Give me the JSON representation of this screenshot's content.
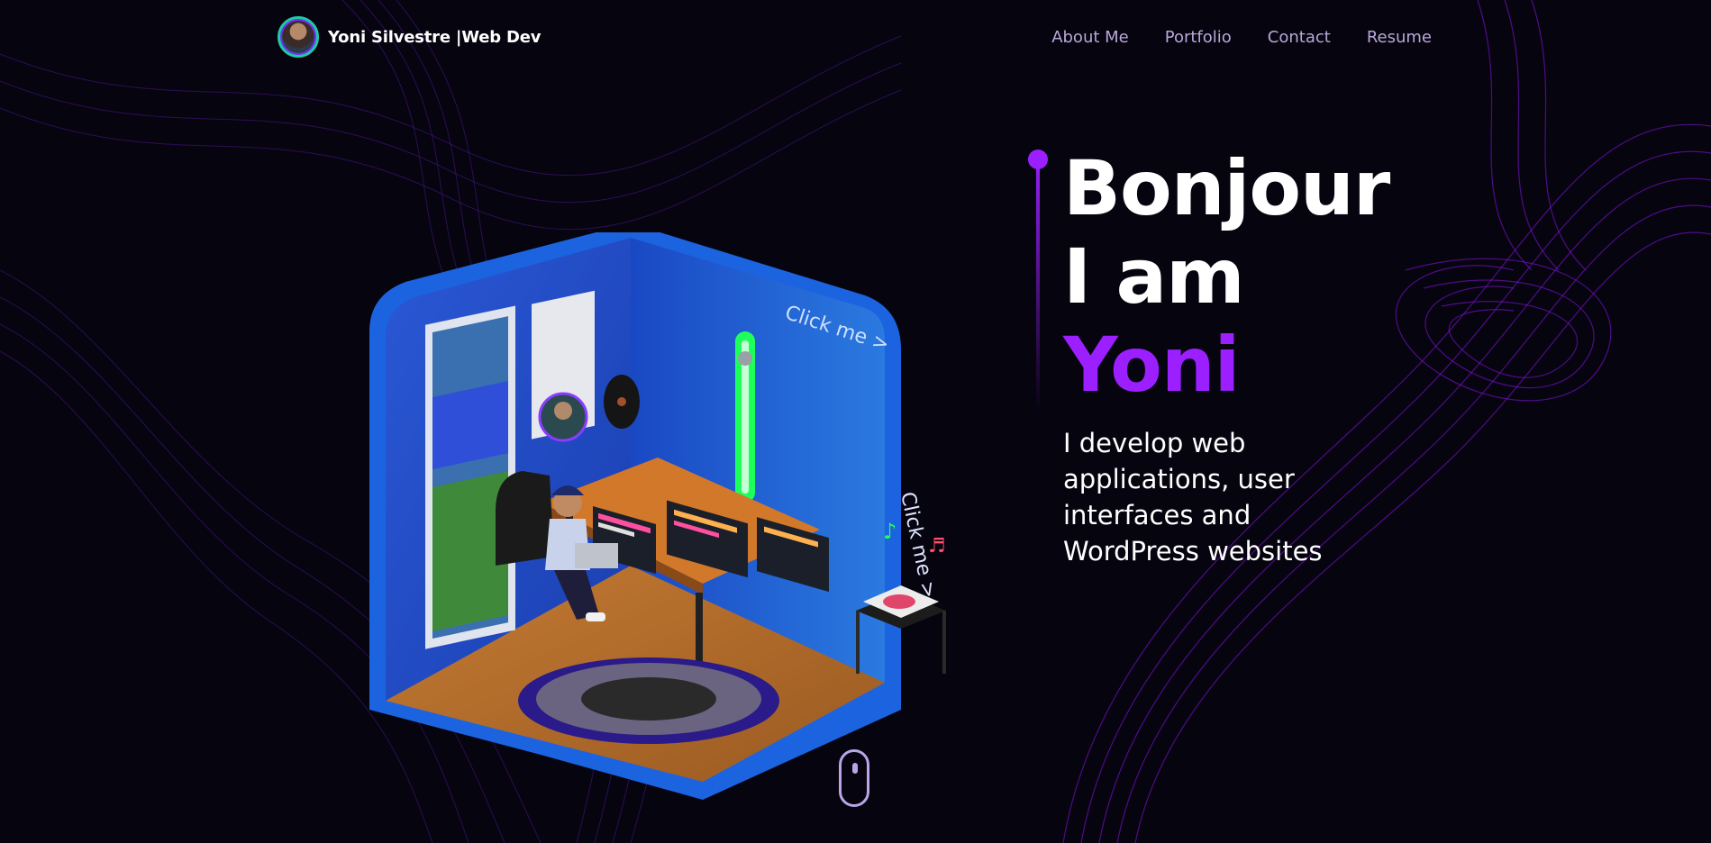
{
  "header": {
    "brand_name": "Yoni Silvestre |Web Dev",
    "nav": [
      {
        "label": "About Me"
      },
      {
        "label": "Portfolio"
      },
      {
        "label": "Contact"
      },
      {
        "label": "Resume"
      }
    ]
  },
  "hero": {
    "greeting_line1": "Bonjour",
    "greeting_line2": "I am",
    "name": "Yoni",
    "tagline": "I develop web applications, user interfaces and WordPress websites"
  },
  "room": {
    "click_hint_top": "Click me  >",
    "click_hint_side": "Click me  >"
  },
  "colors": {
    "accent": "#9b1fff",
    "background": "#06040f",
    "nav_text": "#b8a8d8",
    "room_wall": "#1f4fc8",
    "neon_green": "#1dff5a"
  }
}
